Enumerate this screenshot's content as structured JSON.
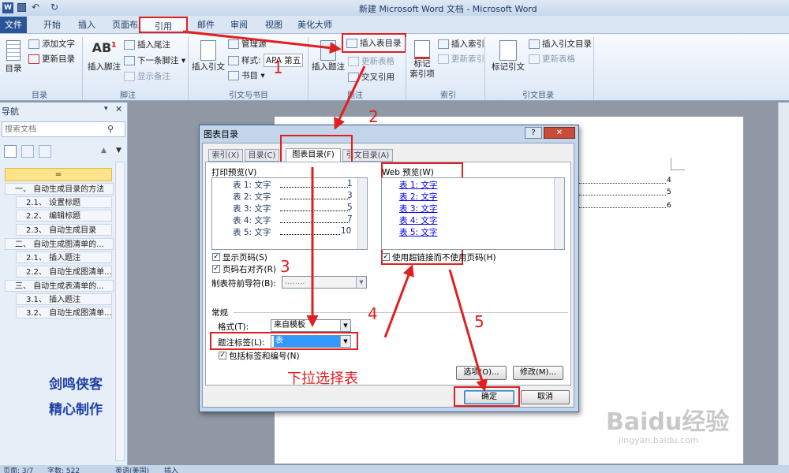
{
  "window_title": "新建 Microsoft Word 文档 - Microsoft Word",
  "ribbon_tabs": [
    "文件",
    "开始",
    "插入",
    "页面布局",
    "引用",
    "邮件",
    "审阅",
    "视图",
    "美化大师"
  ],
  "ribbon": {
    "toc_group": {
      "toc": "目录",
      "add_text": "添加文字",
      "update_toc": "更新目录",
      "label": "目录"
    },
    "footnote_group": {
      "insert_footnote": "插入脚注",
      "insert_endnote": "插入尾注",
      "next_footnote": "下一条脚注",
      "show_notes": "显示备注",
      "label": "脚注"
    },
    "citation_group": {
      "insert_citation": "插入引文",
      "manage_sources": "管理源",
      "style_label": "样式:",
      "style_value": "APA 第五",
      "bibliography": "书目",
      "label": "引文与书目"
    },
    "caption_group": {
      "insert_caption": "插入题注",
      "insert_table_of_figures": "插入表目录",
      "update_table": "更新表格",
      "cross_reference": "交叉引用",
      "label": "题注"
    },
    "index_group": {
      "mark_entry": "标记\n索引项",
      "insert_index": "插入索引",
      "update_index": "更新索引",
      "label": "索引"
    },
    "toa_group": {
      "mark_citation": "标记引文",
      "insert_toa": "插入引文目录",
      "update_table": "更新表格",
      "label": "引文目录"
    }
  },
  "nav": {
    "title": "导航",
    "search_placeholder": "搜索文档",
    "items": [
      "一、 自动生成目录的方法",
      "2.1、 设置标题",
      "2.2、 编辑标题",
      "2.3、 自动生成目录",
      "二、 自动生成图清单的...",
      "2.1、 插入题注",
      "2.2、 自动生成图清单...",
      "三、 自动生成表清单的...",
      "3.1、 插入题注",
      "3.2、 自动生成图清单..."
    ],
    "top_item": "="
  },
  "watermark_text": [
    "剑鸣侠客",
    "精心制作"
  ],
  "doc_page_numbers": [
    "4",
    "5",
    "6"
  ],
  "dialog": {
    "title": "图表目录",
    "help": "?",
    "tabs": [
      "索引(X)",
      "目录(C)",
      "图表目录(F)",
      "引文目录(A)"
    ],
    "print_preview_label": "打印预览(V)",
    "print_rows": [
      {
        "label": "表 1: 文字",
        "page": "1"
      },
      {
        "label": "表 2: 文字",
        "page": "3"
      },
      {
        "label": "表 3: 文字",
        "page": "5"
      },
      {
        "label": "表 4: 文字",
        "page": "7"
      },
      {
        "label": "表 5: 文字",
        "page": "10"
      }
    ],
    "web_preview_label": "Web 预览(W)",
    "web_rows": [
      "表 1: 文字",
      "表 2: 文字",
      "表 3: 文字",
      "表 4: 文字",
      "表 5: 文字"
    ],
    "show_page_numbers": "显示页码(S)",
    "right_align": "页码右对齐(R)",
    "tab_leader_label": "制表符前导符(B):",
    "tab_leader_value": "........",
    "use_hyperlinks": "使用超链接而不使用页码(H)",
    "general_label": "常规",
    "format_label": "格式(T):",
    "format_value": "来自模板",
    "caption_label": "题注标签(L):",
    "caption_value": "表",
    "include_label": "包括标签和编号(N)",
    "options": "选项(O)...",
    "modify": "修改(M)...",
    "ok": "确定",
    "cancel": "取消"
  },
  "annotations": {
    "steps": [
      "1",
      "2",
      "3",
      "4",
      "5"
    ],
    "note": "下拉选择表"
  },
  "status": {
    "page": "页面: 3/7",
    "words": "字数: 522",
    "lang": "英语(美国)",
    "mode": "插入"
  },
  "baidu": {
    "logo": "Baidu经验",
    "url": "jingyan.baidu.com"
  },
  "colors": {
    "accent_red": "#e02020",
    "file_tab": "#2a5699",
    "link_blue": "#0000ee"
  }
}
